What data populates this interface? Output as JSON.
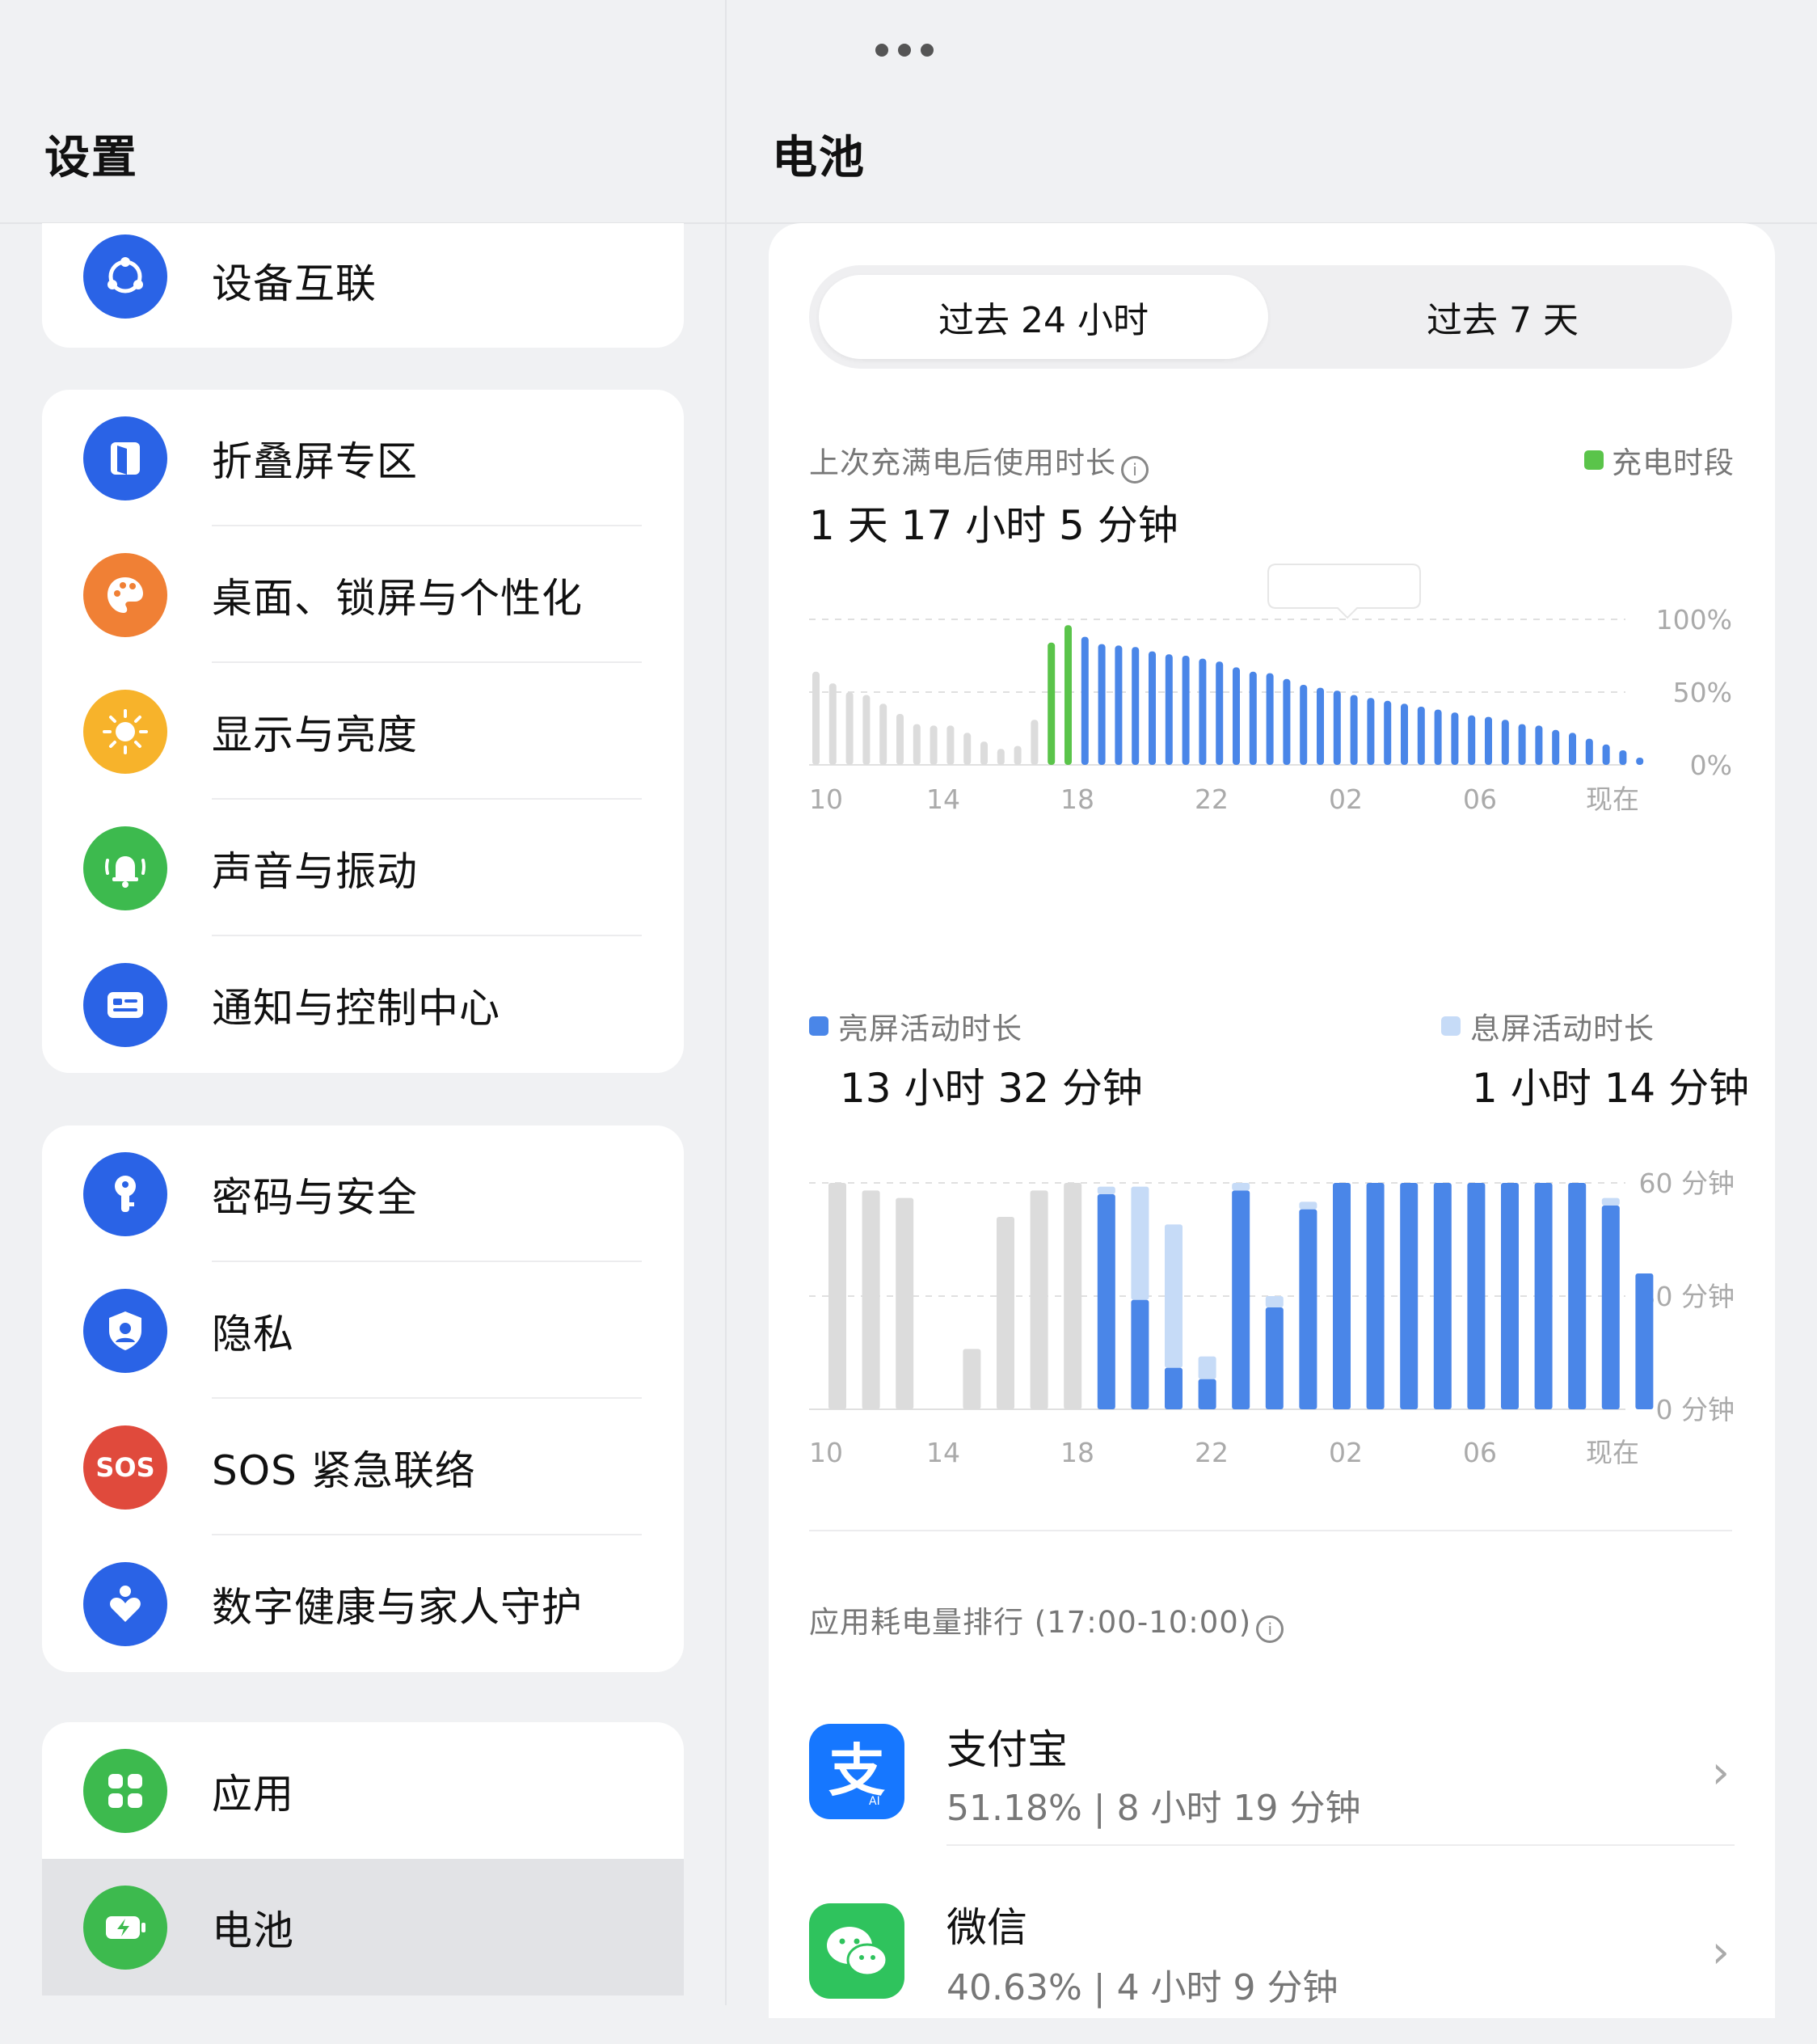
{
  "left": {
    "title": "设置",
    "groups": [
      [
        {
          "label": "设备互联",
          "icon": "device-link-icon",
          "color": "#2a63e6"
        }
      ],
      [
        {
          "label": "折叠屏专区",
          "icon": "fold-screen-icon",
          "color": "#2a63e6"
        },
        {
          "label": "桌面、锁屏与个性化",
          "icon": "palette-icon",
          "color": "#f08035"
        },
        {
          "label": "显示与亮度",
          "icon": "sun-icon",
          "color": "#f7b32b"
        },
        {
          "label": "声音与振动",
          "icon": "bell-icon",
          "color": "#3dba4e"
        },
        {
          "label": "通知与控制中心",
          "icon": "notification-icon",
          "color": "#2a63e6"
        }
      ],
      [
        {
          "label": "密码与安全",
          "icon": "key-icon",
          "color": "#2a63e6"
        },
        {
          "label": "隐私",
          "icon": "shield-icon",
          "color": "#2a63e6"
        },
        {
          "label": "SOS 紧急联络",
          "icon": "sos-icon",
          "color": "#e04a3c",
          "badge": "SOS"
        },
        {
          "label": "数字健康与家人守护",
          "icon": "heart-person-icon",
          "color": "#2a63e6"
        }
      ],
      [
        {
          "label": "应用",
          "icon": "apps-grid-icon",
          "color": "#3dba4e"
        },
        {
          "label": "电池",
          "icon": "battery-icon",
          "color": "#3dba4e",
          "selected": true
        }
      ]
    ]
  },
  "right": {
    "title": "电池",
    "tabs": [
      "过去 24 小时",
      "过去 7 天"
    ],
    "since_full_label": "上次充满电后使用时长",
    "since_full_value": "1 天 17 小时 5 分钟",
    "charging_legend": "充电时段",
    "screen_on_label": "亮屏活动时长",
    "screen_on_value": "13 小时 32 分钟",
    "screen_off_label": "息屏活动时长",
    "screen_off_value": "1 小时 14 分钟",
    "ranking_title": "应用耗电量排行 (17:00-10:00)",
    "apps": [
      {
        "name": "支付宝",
        "detail": "51.18% | 8 小时 19 分钟",
        "icon": "alipay-icon"
      },
      {
        "name": "微信",
        "detail": "40.63% | 4 小时 9 分钟",
        "icon": "wechat-icon"
      }
    ],
    "colors": {
      "charging": "#5ac44a",
      "battery": "#4a86e8",
      "past": "#dcdcdc",
      "screen_on": "#4a86e8",
      "screen_off": "#c6dbf7"
    }
  },
  "chart_data": [
    {
      "type": "bar",
      "title": "",
      "y_ticks": [
        "100%",
        "50%",
        "0%"
      ],
      "x_ticks": [
        "10",
        "14",
        "18",
        "22",
        "02",
        "06",
        "现在"
      ],
      "ylim": [
        0,
        100
      ],
      "series": [
        {
          "name": "past",
          "values": [
            64,
            56,
            50,
            48,
            42,
            35,
            28,
            27,
            27,
            22,
            16,
            11,
            13,
            31,
            0,
            0,
            0,
            0,
            0,
            0,
            0,
            0,
            0,
            0,
            0,
            0,
            0,
            0,
            0,
            0,
            0,
            0,
            0,
            0,
            0,
            0,
            0,
            0,
            0,
            0,
            0,
            0,
            0,
            0,
            0,
            0,
            0,
            0,
            0
          ]
        },
        {
          "name": "充电时段",
          "values": [
            0,
            0,
            0,
            0,
            0,
            0,
            0,
            0,
            0,
            0,
            0,
            0,
            0,
            0,
            84,
            96,
            0,
            0,
            0,
            0,
            0,
            0,
            0,
            0,
            0,
            0,
            0,
            0,
            0,
            0,
            0,
            0,
            0,
            0,
            0,
            0,
            0,
            0,
            0,
            0,
            0,
            0,
            0,
            0,
            0,
            0,
            0,
            0,
            0
          ]
        },
        {
          "name": "battery",
          "values": [
            0,
            0,
            0,
            0,
            0,
            0,
            0,
            0,
            0,
            0,
            0,
            0,
            0,
            0,
            0,
            0,
            88,
            83,
            82,
            81,
            78,
            76,
            75,
            73,
            71,
            67,
            64,
            63,
            59,
            55,
            53,
            51,
            48,
            46,
            44,
            42,
            40,
            38,
            36,
            34,
            33,
            31,
            28,
            27,
            24,
            22,
            18,
            14,
            10,
            5
          ]
        }
      ]
    },
    {
      "type": "bar",
      "title": "",
      "y_ticks": [
        "60 分钟",
        "30 分钟",
        "0 分钟"
      ],
      "x_ticks": [
        "10",
        "14",
        "18",
        "22",
        "02",
        "06",
        "现在"
      ],
      "ylim": [
        0,
        60
      ],
      "series": [
        {
          "name": "past",
          "values": [
            60,
            58,
            56,
            0,
            16,
            51,
            58,
            60,
            0,
            0,
            0,
            0,
            0,
            0,
            0,
            0,
            0,
            0,
            0,
            0,
            0,
            0,
            0,
            0
          ]
        },
        {
          "name": "亮屏活动时长",
          "values": [
            0,
            0,
            0,
            0,
            0,
            0,
            0,
            0,
            57,
            29,
            11,
            8,
            58,
            27,
            53,
            60,
            60,
            60,
            60,
            60,
            60,
            60,
            60,
            54,
            36
          ]
        },
        {
          "name": "息屏活动时长",
          "values": [
            0,
            0,
            0,
            0,
            0,
            0,
            0,
            0,
            2,
            30,
            38,
            6,
            2,
            3,
            2,
            0,
            0,
            0,
            0,
            0,
            0,
            0,
            0,
            2,
            0
          ]
        }
      ]
    }
  ]
}
